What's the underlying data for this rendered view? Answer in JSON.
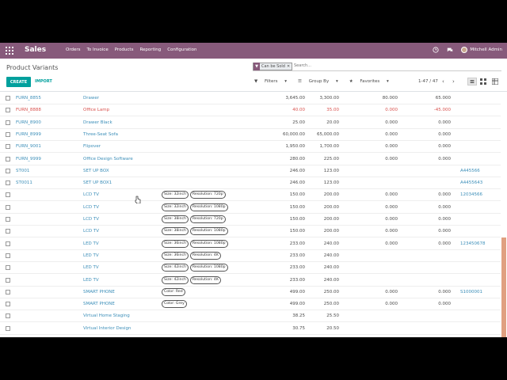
{
  "navbar": {
    "app_name": "Sales",
    "menu": [
      "Orders",
      "To Invoice",
      "Products",
      "Reporting",
      "Configuration"
    ],
    "user": "Mitchell Admin"
  },
  "control_panel": {
    "breadcrumb": "Product Variants",
    "facet_label": "Can be Sold",
    "search_placeholder": "Search...",
    "create_label": "CREATE",
    "import_label": "IMPORT",
    "filters_label": "Filters",
    "groupby_label": "Group By",
    "favorites_label": "Favorites",
    "pager": "1-47 / 47"
  },
  "rows": [
    {
      "ref": "FURN_8855",
      "name": "Drawer",
      "attrs": [],
      "price": "3,645.00",
      "cost": "3,300.00",
      "onhand": "80.000",
      "forecast": "65.000",
      "barcode": ""
    },
    {
      "ref": "FURN_8888",
      "name": "Office Lamp",
      "attrs": [],
      "price": "40.00",
      "cost": "35.00",
      "onhand": "0.000",
      "forecast": "-45.000",
      "barcode": "",
      "negative": true
    },
    {
      "ref": "FURN_8900",
      "name": "Drawer Black",
      "attrs": [],
      "price": "25.00",
      "cost": "20.00",
      "onhand": "0.000",
      "forecast": "0.000",
      "barcode": ""
    },
    {
      "ref": "FURN_8999",
      "name": "Three-Seat Sofa",
      "attrs": [],
      "price": "60,000.00",
      "cost": "65,000.00",
      "onhand": "0.000",
      "forecast": "0.000",
      "barcode": ""
    },
    {
      "ref": "FURN_9001",
      "name": "Flipover",
      "attrs": [],
      "price": "1,950.00",
      "cost": "1,700.00",
      "onhand": "0.000",
      "forecast": "0.000",
      "barcode": ""
    },
    {
      "ref": "FURN_9999",
      "name": "Office Design Software",
      "attrs": [],
      "price": "280.00",
      "cost": "225.00",
      "onhand": "0.000",
      "forecast": "0.000",
      "barcode": ""
    },
    {
      "ref": "ST001",
      "name": "SET UP BOX",
      "attrs": [],
      "price": "246.00",
      "cost": "123.00",
      "onhand": "",
      "forecast": "",
      "barcode": "A445566"
    },
    {
      "ref": "ST0011",
      "name": "SET UP BOX1",
      "attrs": [],
      "price": "246.00",
      "cost": "123.00",
      "onhand": "",
      "forecast": "",
      "barcode": "A4455643"
    },
    {
      "ref": "",
      "name": "LCD TV",
      "attrs": [
        "Size: 32inch",
        "Resolution: 720p"
      ],
      "price": "150.00",
      "cost": "200.00",
      "onhand": "0.000",
      "forecast": "0.000",
      "barcode": "12034566"
    },
    {
      "ref": "",
      "name": "LCD TV",
      "attrs": [
        "Size: 32inch",
        "Resolution: 1080p"
      ],
      "price": "150.00",
      "cost": "200.00",
      "onhand": "0.000",
      "forecast": "0.000",
      "barcode": ""
    },
    {
      "ref": "",
      "name": "LCD TV",
      "attrs": [
        "Size: 38inch",
        "Resolution: 720p"
      ],
      "price": "150.00",
      "cost": "200.00",
      "onhand": "0.000",
      "forecast": "0.000",
      "barcode": ""
    },
    {
      "ref": "",
      "name": "LCD TV",
      "attrs": [
        "Size: 38inch",
        "Resolution: 1080p"
      ],
      "price": "150.00",
      "cost": "200.00",
      "onhand": "0.000",
      "forecast": "0.000",
      "barcode": ""
    },
    {
      "ref": "",
      "name": "LED TV",
      "attrs": [
        "Size: 36inch",
        "Resolution: 1080p"
      ],
      "price": "233.00",
      "cost": "240.00",
      "onhand": "0.000",
      "forecast": "0.000",
      "barcode": "123450678"
    },
    {
      "ref": "",
      "name": "LED TV",
      "attrs": [
        "Size: 36inch",
        "Resolution: 4K"
      ],
      "price": "233.00",
      "cost": "240.00",
      "onhand": "",
      "forecast": "",
      "barcode": ""
    },
    {
      "ref": "",
      "name": "LED TV",
      "attrs": [
        "Size: 42inch",
        "Resolution: 1080p"
      ],
      "price": "233.00",
      "cost": "240.00",
      "onhand": "",
      "forecast": "",
      "barcode": ""
    },
    {
      "ref": "",
      "name": "LED TV",
      "attrs": [
        "Size: 42inch",
        "Resolution: 4K"
      ],
      "price": "233.00",
      "cost": "240.00",
      "onhand": "",
      "forecast": "",
      "barcode": ""
    },
    {
      "ref": "",
      "name": "SMART PHONE",
      "attrs": [
        "Color: Red"
      ],
      "price": "499.00",
      "cost": "250.00",
      "onhand": "0.000",
      "forecast": "0.000",
      "barcode": "S1000001"
    },
    {
      "ref": "",
      "name": "SMART PHONE",
      "attrs": [
        "Color: Grey"
      ],
      "price": "499.00",
      "cost": "250.00",
      "onhand": "0.000",
      "forecast": "0.000",
      "barcode": ""
    },
    {
      "ref": "",
      "name": "Virtual Home Staging",
      "attrs": [],
      "price": "38.25",
      "cost": "25.50",
      "onhand": "",
      "forecast": "",
      "barcode": ""
    },
    {
      "ref": "",
      "name": "Virtual Interior Design",
      "attrs": [],
      "price": "30.75",
      "cost": "20.50",
      "onhand": "",
      "forecast": "",
      "barcode": ""
    }
  ],
  "colors": {
    "brand": "#875a7b",
    "accent": "#00a09d",
    "link": "#3d8fb9",
    "negative": "#d9534f"
  }
}
